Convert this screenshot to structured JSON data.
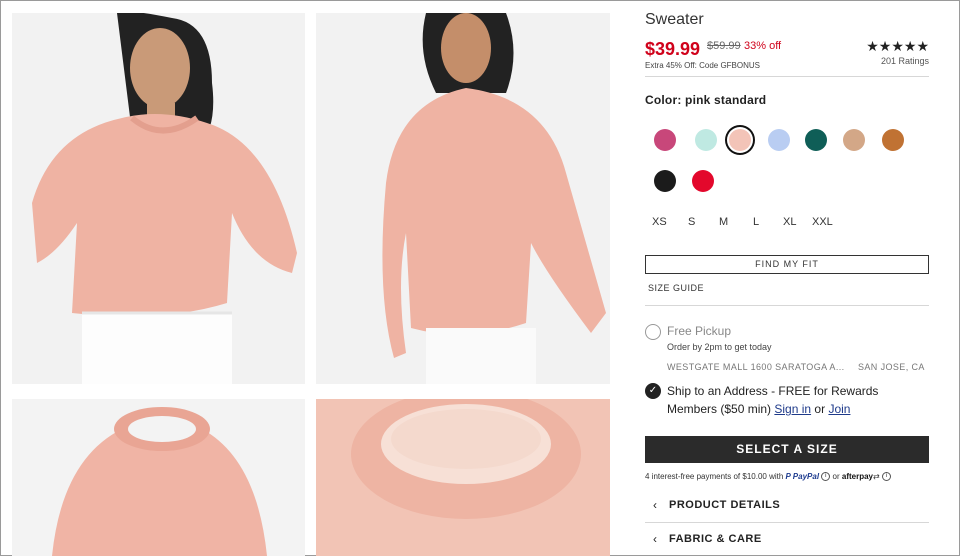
{
  "product": {
    "title": "Sweater",
    "price": "$39.99",
    "was_price": "$59.99",
    "discount": "33% off",
    "promo": "Extra 45% Off: Code GFBONUS",
    "stars": "★★★★★",
    "ratings": "201 Ratings"
  },
  "color": {
    "label": "Color: pink standard",
    "swatches": [
      {
        "name": "raspberry",
        "hex": "#c8477a"
      },
      {
        "name": "mint",
        "hex": "#bfe9e2"
      },
      {
        "name": "pink standard",
        "hex": "#f3c4b8",
        "selected": true
      },
      {
        "name": "periwinkle",
        "hex": "#b9cdf2"
      },
      {
        "name": "teal",
        "hex": "#0f5e57"
      },
      {
        "name": "camel",
        "hex": "#d3a787"
      },
      {
        "name": "cognac",
        "hex": "#c07233"
      },
      {
        "name": "black",
        "hex": "#1b1b1b"
      },
      {
        "name": "red",
        "hex": "#e3082c"
      }
    ]
  },
  "sizes": [
    "XS",
    "S",
    "M",
    "L",
    "XL",
    "XXL"
  ],
  "fit": {
    "button": "FIND MY FIT",
    "guide": "SIZE GUIDE"
  },
  "pickup": {
    "label": "Free Pickup",
    "order_by": "Order by 2pm to get today",
    "store": "WESTGATE MALL 1600 SARATOGA A...",
    "city": "SAN JOSE, CA"
  },
  "ship": {
    "text": "Ship to an Address - FREE for Rewards Members ($50 min)",
    "sign_in": "Sign in",
    "or": "or",
    "join": "Join"
  },
  "cta": "SELECT A SIZE",
  "payments": {
    "text": "4 interest-free payments of $10.00 with",
    "paypal": "PayPal",
    "or": "or",
    "afterpay": "afterpay"
  },
  "accordions": [
    "PRODUCT DETAILS",
    "FABRIC & CARE"
  ]
}
